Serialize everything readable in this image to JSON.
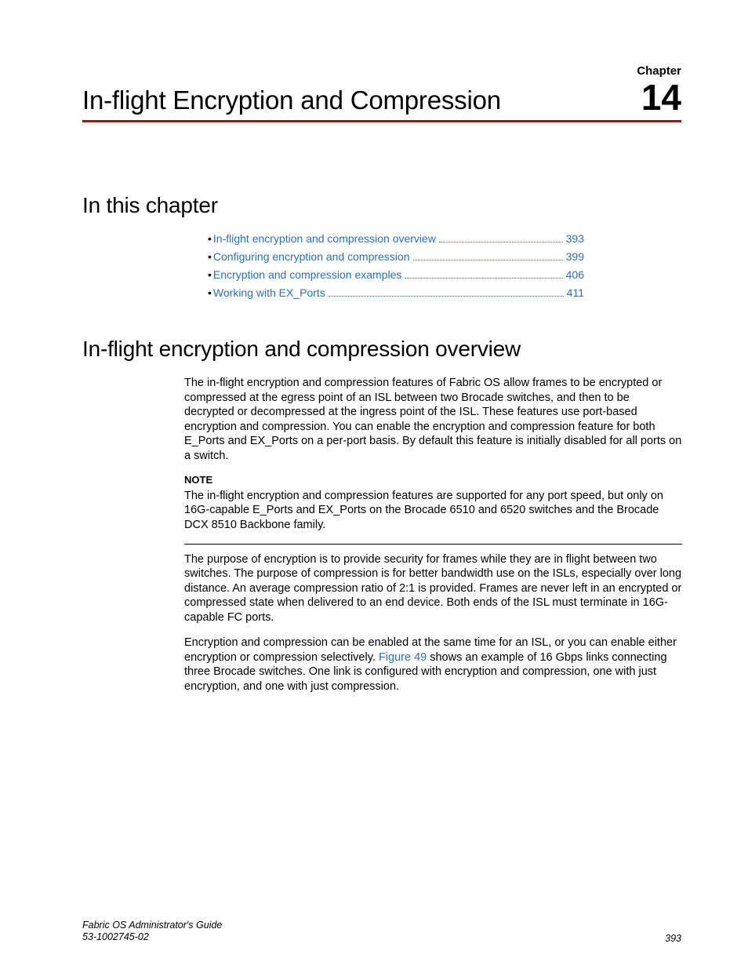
{
  "header": {
    "chapter_label": "Chapter",
    "chapter_number": "14",
    "title": "In-flight Encryption and Compression"
  },
  "sections": {
    "in_this_chapter": "In this chapter",
    "overview_heading": "In-flight encryption and compression overview"
  },
  "toc": [
    {
      "label": "In-flight encryption and compression overview",
      "page": "393"
    },
    {
      "label": "Configuring encryption and compression",
      "page": "399"
    },
    {
      "label": "Encryption and compression examples",
      "page": "406"
    },
    {
      "label": "Working with EX_Ports",
      "page": "411"
    }
  ],
  "body": {
    "p1": "The in-flight encryption and compression features of Fabric OS allow frames to be encrypted or compressed at the egress point of an ISL between two Brocade switches, and then to be decrypted or decompressed at the ingress point of the ISL. These features use port-based encryption and compression. You can enable the encryption and compression feature for both E_Ports and EX_Ports on a per-port basis. By default this feature is initially disabled for all ports on a switch.",
    "note_label": "NOTE",
    "note_text": "The in-flight encryption and compression features are supported for any port speed, but only on 16G-capable E_Ports and EX_Ports on the Brocade 6510 and 6520 switches and the Brocade DCX 8510 Backbone family.",
    "p2": "The purpose of encryption is to provide security for frames while they are in flight between two switches. The purpose of compression is for better bandwidth use on the ISLs, especially over long distance. An average compression ratio of 2:1 is provided. Frames are never left in an encrypted or compressed state when delivered to an end device. Both ends of the ISL must terminate in 16G-capable FC ports.",
    "p3a": "Encryption and compression can be enabled at the same time for an ISL, or you can enable either encryption or compression selectively. ",
    "fig_ref": "Figure 49",
    "p3b": " shows an example of 16 Gbps links connecting three Brocade switches. One link is configured with encryption and compression, one with just encryption, and one with just compression."
  },
  "footer": {
    "guide": "Fabric OS Administrator's Guide",
    "docnum": "53-1002745-02",
    "page": "393"
  }
}
